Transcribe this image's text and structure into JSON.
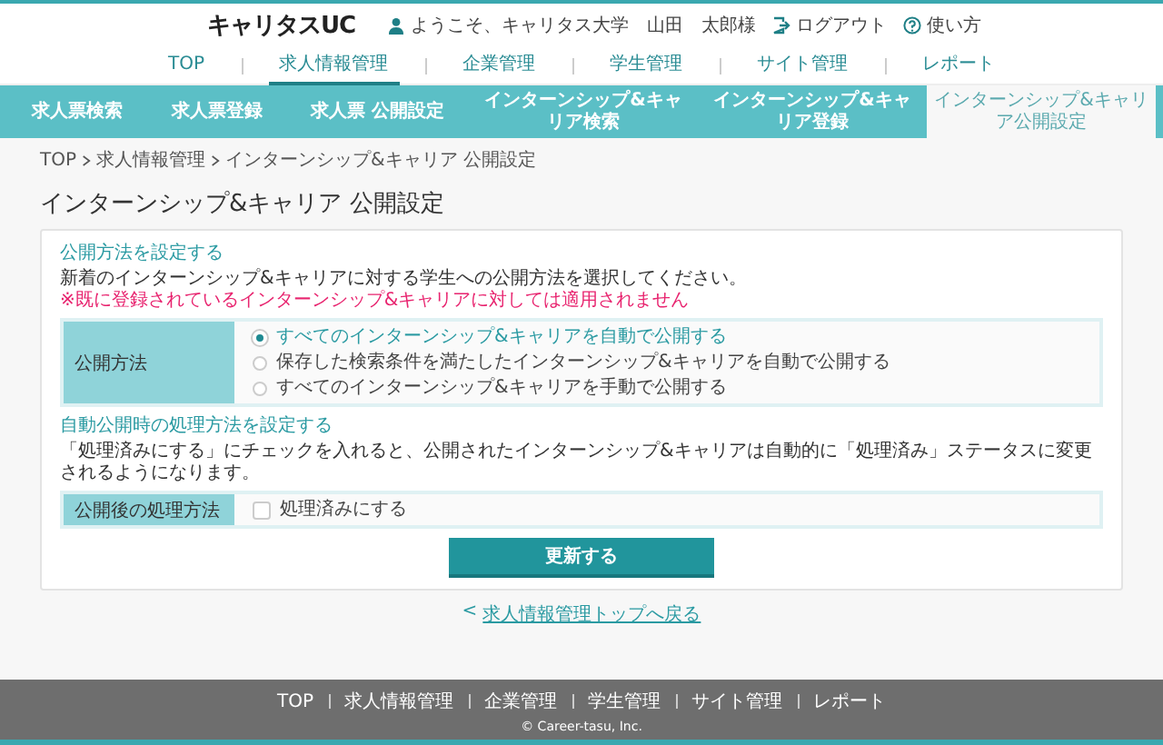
{
  "header": {
    "logo": "キャリタスUC",
    "greeting": "ようこそ、キャリタス大学　山田　太郎様",
    "logout": "ログアウト",
    "help": "使い方"
  },
  "main_nav": [
    {
      "label": "TOP",
      "selected": false
    },
    {
      "label": "求人情報管理",
      "selected": true
    },
    {
      "label": "企業管理",
      "selected": false
    },
    {
      "label": "学生管理",
      "selected": false
    },
    {
      "label": "サイト管理",
      "selected": false
    },
    {
      "label": "レポート",
      "selected": false
    }
  ],
  "sub_nav": [
    {
      "label": "求人票検索",
      "selected": false
    },
    {
      "label": "求人票登録",
      "selected": false
    },
    {
      "label": "求人票 公開設定",
      "selected": false
    },
    {
      "label": "インターンシップ&キャリア検索",
      "selected": false
    },
    {
      "label": "インターンシップ&キャリア登録",
      "selected": false
    },
    {
      "label": "インターンシップ&キャリア公開設定",
      "selected": true
    }
  ],
  "breadcrumb": [
    "TOP",
    "求人情報管理",
    "インターンシップ&キャリア 公開設定"
  ],
  "title": "インターンシップ&キャリア 公開設定",
  "sections": [
    {
      "heading": "公開方法を設定する",
      "description": "新着のインターンシップ&キャリアに対する学生への公開方法を選択してください。",
      "warning": "※既に登録されているインターンシップ&キャリアに対しては適用されません",
      "field_label": "公開方法",
      "kind": "radio",
      "options": [
        {
          "label": "すべてのインターンシップ&キャリアを自動で公開する",
          "selected": true
        },
        {
          "label": "保存した検索条件を満たしたインターンシップ&キャリアを自動で公開する",
          "selected": false
        },
        {
          "label": "すべてのインターンシップ&キャリアを手動で公開する",
          "selected": false
        }
      ]
    },
    {
      "heading": "自動公開時の処理方法を設定する",
      "description": "「処理済みにする」にチェックを入れると、公開されたインターンシップ&キャリアは自動的に「処理済み」ステータスに変更されるようになります。",
      "field_label": "公開後の処理方法",
      "kind": "checkbox",
      "options": [
        {
          "label": "処理済みにする",
          "checked": false
        }
      ]
    }
  ],
  "submit_button": "更新する",
  "back_link": {
    "arrow": "<",
    "label": "求人情報管理トップへ戻る"
  },
  "footer": {
    "links": [
      "TOP",
      "求人情報管理",
      "企業管理",
      "学生管理",
      "サイト管理",
      "レポート"
    ],
    "copyright": "© Career-tasu, Inc."
  }
}
